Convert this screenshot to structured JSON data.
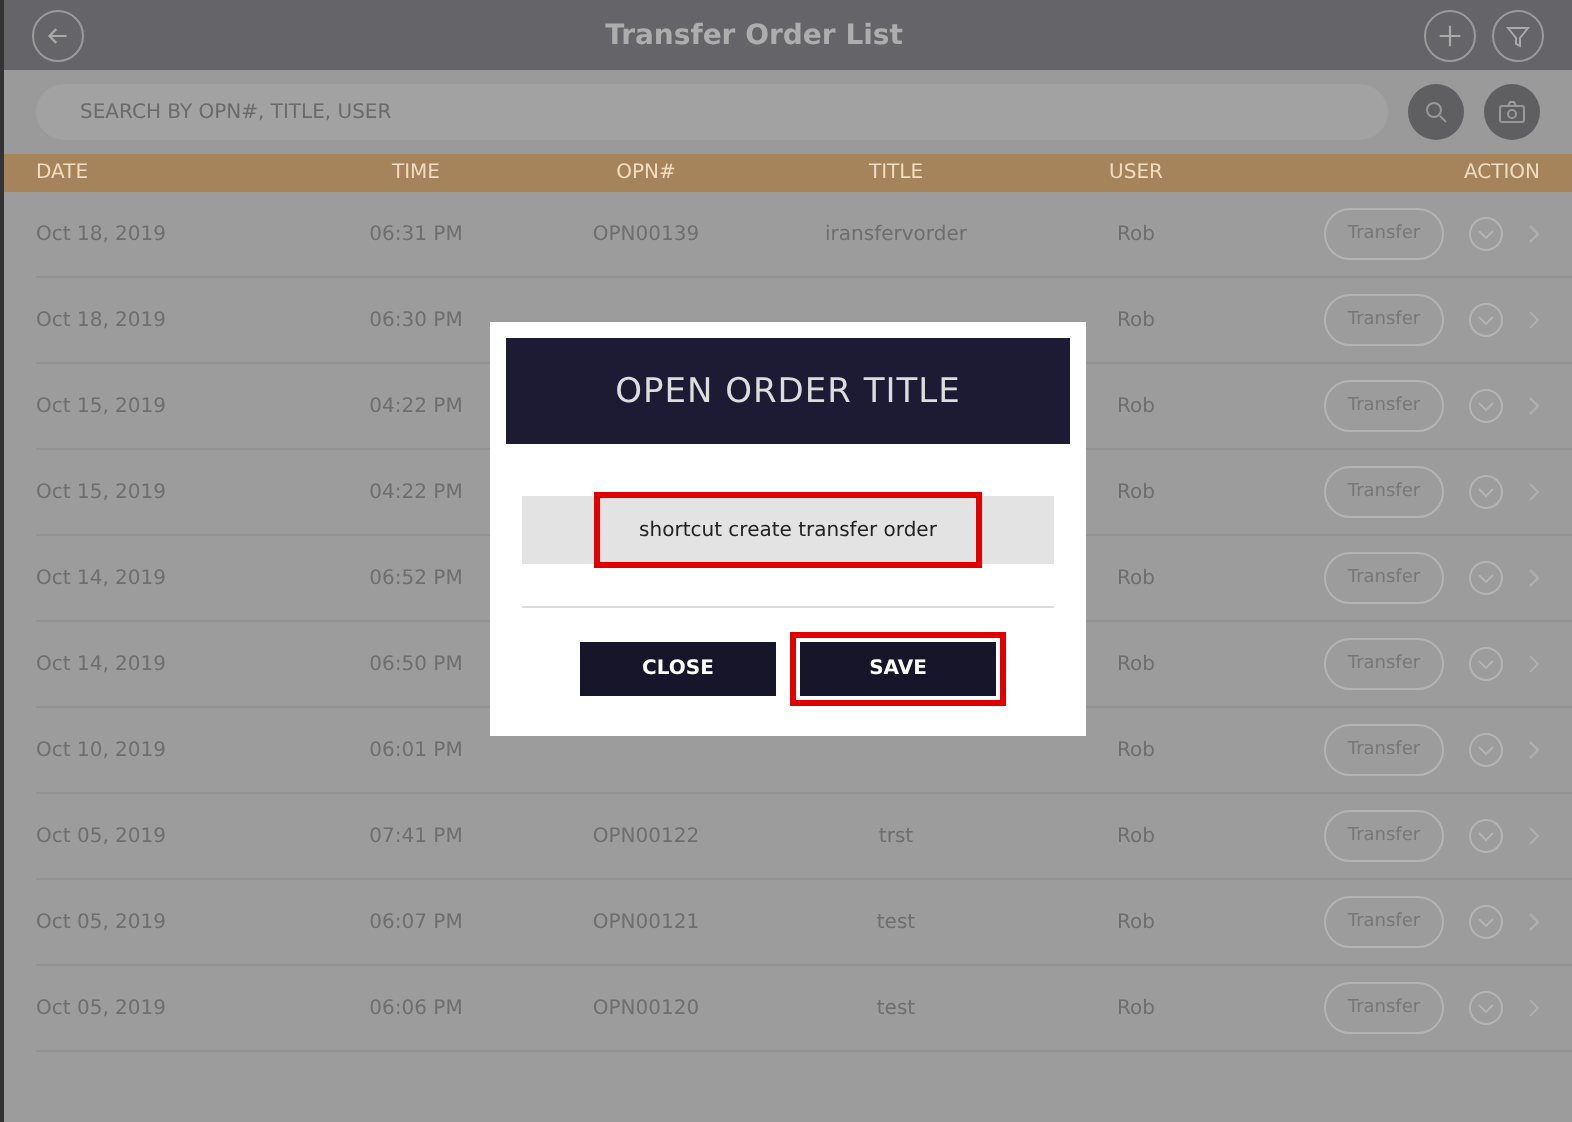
{
  "header": {
    "title": "Transfer Order List"
  },
  "search": {
    "placeholder": "SEARCH BY OPN#, TITLE, USER"
  },
  "table": {
    "columns": [
      "DATE",
      "TIME",
      "OPN#",
      "TITLE",
      "USER",
      "ACTION"
    ],
    "rows": [
      {
        "date": "Oct 18, 2019",
        "time": "06:31 PM",
        "opn": "OPN00139",
        "title": "iransfervorder",
        "user": "Rob",
        "action": "Transfer"
      },
      {
        "date": "Oct 18, 2019",
        "time": "06:30 PM",
        "user": "Rob",
        "action": "Transfer"
      },
      {
        "date": "Oct 15, 2019",
        "time": "04:22 PM",
        "user": "Rob",
        "action": "Transfer"
      },
      {
        "date": "Oct 15, 2019",
        "time": "04:22 PM",
        "user": "Rob",
        "action": "Transfer"
      },
      {
        "date": "Oct 14, 2019",
        "time": "06:52 PM",
        "user": "Rob",
        "action": "Transfer"
      },
      {
        "date": "Oct 14, 2019",
        "time": "06:50 PM",
        "user": "Rob",
        "action": "Transfer"
      },
      {
        "date": "Oct 10, 2019",
        "time": "06:01 PM",
        "user": "Rob",
        "action": "Transfer"
      },
      {
        "date": "Oct 05, 2019",
        "time": "07:41 PM",
        "opn": "OPN00122",
        "title": "trst",
        "user": "Rob",
        "action": "Transfer"
      },
      {
        "date": "Oct 05, 2019",
        "time": "06:07 PM",
        "opn": "OPN00121",
        "title": "test",
        "user": "Rob",
        "action": "Transfer"
      },
      {
        "date": "Oct 05, 2019",
        "time": "06:06 PM",
        "opn": "OPN00120",
        "title": "test",
        "user": "Rob",
        "action": "Transfer"
      }
    ]
  },
  "dialog": {
    "title": "OPEN ORDER TITLE",
    "field": {
      "value": "shortcut create transfer order",
      "highlighted": true
    },
    "buttons": [
      {
        "label": "CLOSE",
        "highlighted": false
      },
      {
        "label": "SAVE",
        "highlighted": true
      }
    ]
  }
}
